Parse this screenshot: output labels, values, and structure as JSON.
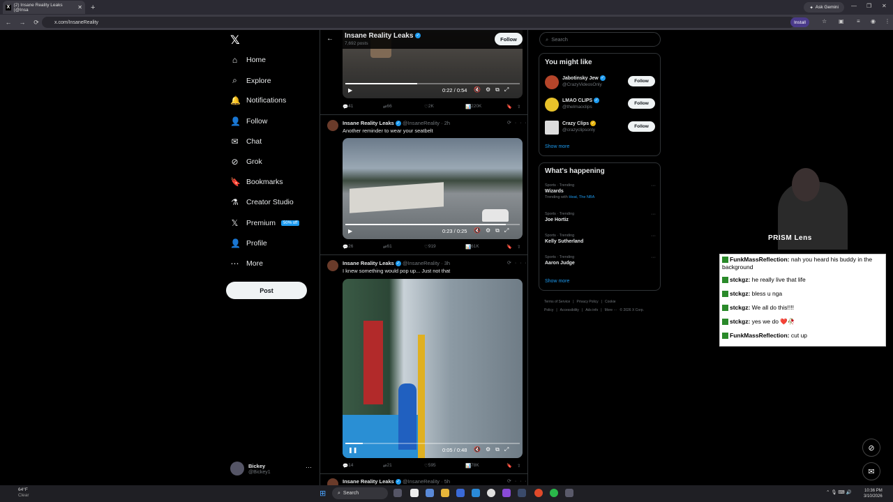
{
  "browser": {
    "tab_title": "(2) Insane Reality Leaks (@Insa",
    "ask_gemini": "Ask Gemini",
    "url": "x.com/InsaneReality",
    "install": "Install"
  },
  "nav": {
    "items": [
      {
        "label": "Home",
        "icon": "home-icon"
      },
      {
        "label": "Explore",
        "icon": "search-icon"
      },
      {
        "label": "Notifications",
        "icon": "bell-icon"
      },
      {
        "label": "Follow",
        "icon": "person-add-icon"
      },
      {
        "label": "Chat",
        "icon": "mail-icon"
      },
      {
        "label": "Grok",
        "icon": "grok-icon"
      },
      {
        "label": "Bookmarks",
        "icon": "bookmark-icon"
      },
      {
        "label": "Creator Studio",
        "icon": "flask-icon"
      },
      {
        "label": "Premium",
        "icon": "x-icon"
      },
      {
        "label": "Profile",
        "icon": "person-icon"
      },
      {
        "label": "More",
        "icon": "more-circle-icon"
      }
    ],
    "premium_badge": "50% off",
    "post": "Post"
  },
  "account": {
    "name": "Bickey",
    "handle": "@Bickey1"
  },
  "profile_header": {
    "name": "Insane Reality Leaks",
    "posts": "7,692 posts",
    "follow": "Follow"
  },
  "tweets": [
    {
      "video_time": "0:22 / 0:54",
      "progress": 0.41,
      "replies": "41",
      "reposts": "66",
      "likes": "2K",
      "views": "220K"
    },
    {
      "name": "Insane Reality Leaks",
      "handle": "@InsaneReality · 2h",
      "text": "Another reminder to wear your seatbelt",
      "video_time": "0:23 / 0:25",
      "progress": 0.92,
      "replies": "26",
      "reposts": "61",
      "likes": "919",
      "views": "61K"
    },
    {
      "name": "Insane Reality Leaks",
      "handle": "@InsaneReality · 3h",
      "text": "I knew something would pop up... Just not that",
      "video_time": "0:05 / 0:48",
      "progress": 0.1,
      "replies": "14",
      "reposts": "21",
      "likes": "595",
      "views": "78K"
    },
    {
      "name": "Insane Reality Leaks",
      "handle": "@InsaneReality · 5h"
    }
  ],
  "right": {
    "search_placeholder": "Search",
    "you_might_like": "You might like",
    "suggestions": [
      {
        "name": "Jabotinsky Jew",
        "handle": "@CrazyVideosOnly",
        "follow": "Follow"
      },
      {
        "name": "LMAO CLIPS",
        "handle": "@thelmaoclips",
        "follow": "Follow"
      },
      {
        "name": "Crazy Clips",
        "handle": "@crazyclipsonly",
        "follow": "Follow"
      }
    ],
    "show_more": "Show more",
    "whats_happening": "What's happening",
    "trends": [
      {
        "context": "Sports · Trending",
        "name": "Wizards",
        "extra_prefix": "Trending with ",
        "extra_links": "Heat, The NBA"
      },
      {
        "context": "Sports · Trending",
        "name": "Joe Hortiz"
      },
      {
        "context": "Sports · Trending",
        "name": "Kelly Sutherland"
      },
      {
        "context": "Sports · Trending",
        "name": "Aaron Judge"
      }
    ],
    "show_more_2": "Show more",
    "footer": [
      "Terms of Service",
      "|",
      "Privacy Policy",
      "|",
      "Cookie Policy",
      "|",
      "Accessibility",
      "|",
      "Ads info",
      "|",
      "More ···",
      "© 2026 X Corp."
    ]
  },
  "stream": {
    "lens": "PRISM Lens",
    "chat": [
      {
        "user": "FunkMassReflection:",
        "msg": "nah you heard his buddy in the background"
      },
      {
        "user": "stckgz:",
        "msg": "he really live that life"
      },
      {
        "user": "stckgz:",
        "msg": "bless u nga"
      },
      {
        "user": "stckgz:",
        "msg": "We all do this!!!!"
      },
      {
        "user": "stckgz:",
        "msg": "yes we do ❤️🥀"
      },
      {
        "user": "FunkMassReflection:",
        "msg": "cut up"
      }
    ]
  },
  "taskbar": {
    "temp": "64°F",
    "weather": "Clear",
    "search": "Search",
    "time": "10:36 PM",
    "date": "3/10/2026"
  }
}
